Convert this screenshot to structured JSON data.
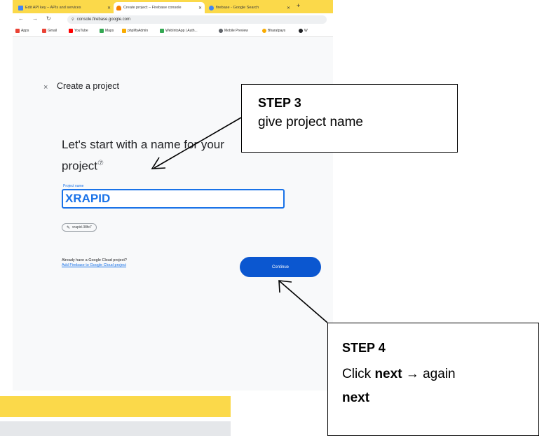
{
  "browser": {
    "tabs": [
      {
        "title": "Edit API key – APIs and services",
        "favicon_color": "#4285f4"
      },
      {
        "title": "Create project – Firebase console",
        "favicon_color": "#f57c00"
      },
      {
        "title": "firebase - Google Search",
        "favicon_color": "#4285f4"
      }
    ],
    "new_tab": "+",
    "address": "console.firebase.google.com",
    "bookmarks": [
      {
        "label": "Apps",
        "color": "#ea4335"
      },
      {
        "label": "Gmail",
        "color": "#ea4335"
      },
      {
        "label": "YouTube",
        "color": "#ff0000"
      },
      {
        "label": "Maps",
        "color": "#34a853"
      },
      {
        "label": "phpMyAdmin",
        "color": "#f9ab00"
      },
      {
        "label": "WebIntoApp | Auth...",
        "color": "#34a853"
      },
      {
        "label": "Mobile Preview",
        "color": "#5f6368"
      },
      {
        "label": "Bharatpays",
        "color": "#f9ab00"
      },
      {
        "label": "W",
        "color": "#202124"
      }
    ]
  },
  "dialog": {
    "close_icon": "×",
    "title": "Create a project",
    "heading": "Let's start with a name for your project",
    "help_icon": "⑦",
    "field_label": "Project name",
    "field_value": "XRAPID",
    "project_id": "xrapid-38fe7",
    "cloud_question": "Already have a Google Cloud project?",
    "cloud_link": "Add Firebase to Google Cloud project",
    "continue_label": "Continue"
  },
  "callouts": {
    "step3": {
      "title": "STEP 3",
      "text": "give project name"
    },
    "step4": {
      "title": "STEP 4",
      "text_prefix": "Click ",
      "next1": "next",
      "arrow": " → ",
      "again": "again",
      "next2": "next"
    }
  }
}
